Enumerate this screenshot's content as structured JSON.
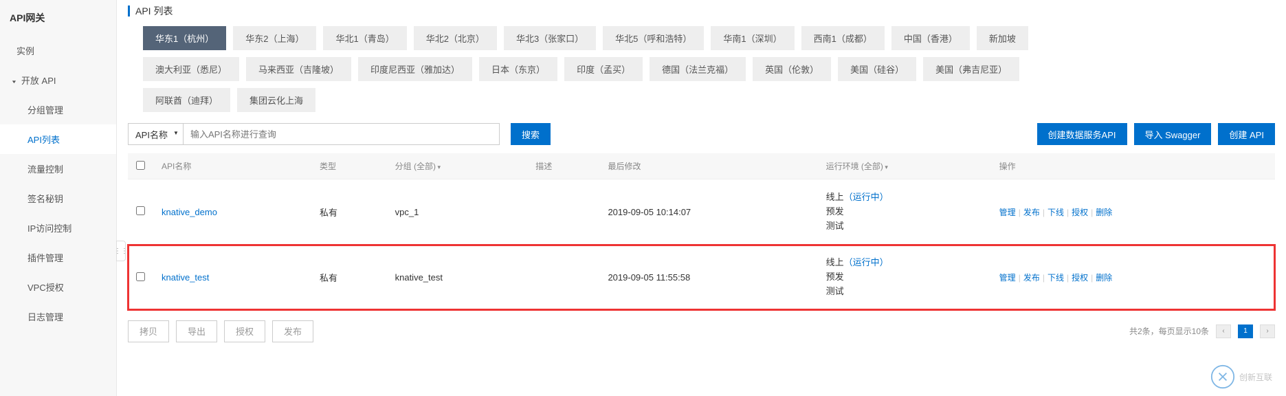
{
  "sidebar": {
    "title": "API网关",
    "items": [
      {
        "label": "实例",
        "sub": false,
        "active": false
      },
      {
        "label": "开放 API",
        "group": true
      },
      {
        "label": "分组管理",
        "sub": true,
        "active": false
      },
      {
        "label": "API列表",
        "sub": true,
        "active": true
      },
      {
        "label": "流量控制",
        "sub": true,
        "active": false
      },
      {
        "label": "签名秘钥",
        "sub": true,
        "active": false
      },
      {
        "label": "IP访问控制",
        "sub": true,
        "active": false
      },
      {
        "label": "插件管理",
        "sub": true,
        "active": false
      },
      {
        "label": "VPC授权",
        "sub": true,
        "active": false
      },
      {
        "label": "日志管理",
        "sub": true,
        "active": false
      }
    ]
  },
  "page": {
    "title": "API 列表"
  },
  "regions_row1": [
    "华东1（杭州）",
    "华东2（上海）",
    "华北1（青岛）",
    "华北2（北京）",
    "华北3（张家口）",
    "华北5（呼和浩特）",
    "华南1（深圳）",
    "西南1（成都）",
    "中国（香港）",
    "新加坡"
  ],
  "regions_row2": [
    "澳大利亚（悉尼）",
    "马来西亚（吉隆坡）",
    "印度尼西亚（雅加达）",
    "日本（东京）",
    "印度（孟买）",
    "德国（法兰克福）",
    "英国（伦敦）",
    "美国（硅谷）",
    "美国（弗吉尼亚）"
  ],
  "regions_row3": [
    "阿联酋（迪拜）",
    "集团云化上海"
  ],
  "region_active": "华东1（杭州）",
  "filter": {
    "select_label": "API名称",
    "placeholder": "输入API名称进行查询",
    "search_btn": "搜索",
    "create_data_api": "创建数据服务API",
    "import_swagger": "导入 Swagger",
    "create_api": "创建 API"
  },
  "table": {
    "headers": {
      "name": "API名称",
      "type": "类型",
      "group": "分组 (全部)",
      "desc": "描述",
      "modified": "最后修改",
      "env": "运行环境 (全部)",
      "ops": "操作"
    },
    "env_labels": {
      "online": "线上",
      "running": "（运行中）",
      "pre": "预发",
      "test": "测试"
    },
    "ops_labels": {
      "manage": "管理",
      "publish": "发布",
      "offline": "下线",
      "auth": "授权",
      "delete": "删除"
    },
    "rows": [
      {
        "name": "knative_demo",
        "type": "私有",
        "group": "vpc_1",
        "desc": "",
        "modified": "2019-09-05 10:14:07",
        "highlight": false
      },
      {
        "name": "knative_test",
        "type": "私有",
        "group": "knative_test",
        "desc": "",
        "modified": "2019-09-05 11:55:58",
        "highlight": true
      }
    ]
  },
  "footer": {
    "buttons": [
      "拷贝",
      "导出",
      "授权",
      "发布"
    ],
    "summary": "共2条，每页显示10条"
  },
  "watermark": {
    "brand": "创新互联"
  }
}
